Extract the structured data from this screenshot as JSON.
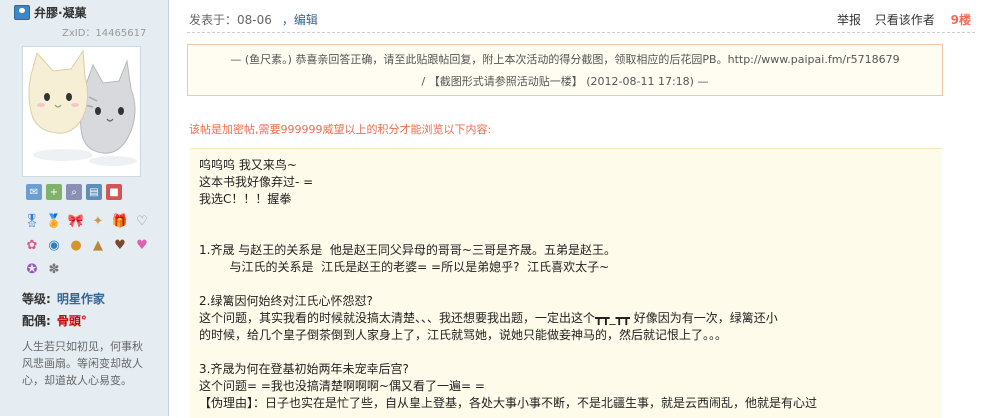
{
  "user": {
    "name": "弁膠·凝菓",
    "zxid": "ZxID：14465617",
    "level_label": "等级:",
    "level_value": "明星作家",
    "spouse_label": "配偶:",
    "spouse_value": "骨頭°",
    "signature": "人生若只如初见，何事秋风悲画扇。等闲变却故人心，却道故人心易变。"
  },
  "post": {
    "posted_label": "发表于：08-06",
    "edit_label": "，编辑",
    "report_label": "举报",
    "only_author_label": "只看该作者",
    "floor_label": "9楼",
    "notice_line1": "— (鱼尺素。) 恭喜亲回答正确，请至此贴跟帖回复，附上本次活动的得分截图，领取相应的后花园PB。http://www.paipai.fm/r5718679",
    "notice_line2": "/ 【截图形式请参照活动贴一楼】 (2012-08-11 17:18) —",
    "locked_notice": "该帖是加密帖,需要999999威望以上的积分才能浏览以下内容:",
    "lines": [
      "呜呜呜 我又来鸟~",
      "这本书我好像弃过- =",
      "我选C！！！握拳",
      "",
      "",
      "1.齐晟 与赵王的关系是  他是赵王同父异母的哥哥~三哥是齐晟。五弟是赵王。",
      "        与江氏的关系是  江氏是赵王的老婆= =所以是弟媳乎?  江氏喜欢太子~",
      "",
      "2.绿篱因何始终对江氏心怀怨怼?",
      "这个问题，其实我看的时候就没搞太清楚、、、我还想要我出题，一定出这个┳┳_┳┳ 好像因为有一次，绿篱还小",
      "的时候，给几个皇子倒茶倒到人家身上了，江氏就骂她，说她只能做妾神马的，然后就记恨上了。。。",
      "",
      "3.齐晟为何在登基初始两年未宠幸后宫?",
      "这个问题= =我也没搞清楚啊啊啊~偶又看了一遍= =",
      "【伪理由】：日子也实在是忙了些，自从皇上登基，各处大事小事不断，不是北疆生事，就是云西闹乱，他就是有心过"
    ]
  },
  "colors": {
    "accent": "#336699",
    "floor": "#f26c4f",
    "notice_bg": "#fffdf2",
    "content_bg": "#fffbea",
    "side_bg": "#e5edf2"
  }
}
